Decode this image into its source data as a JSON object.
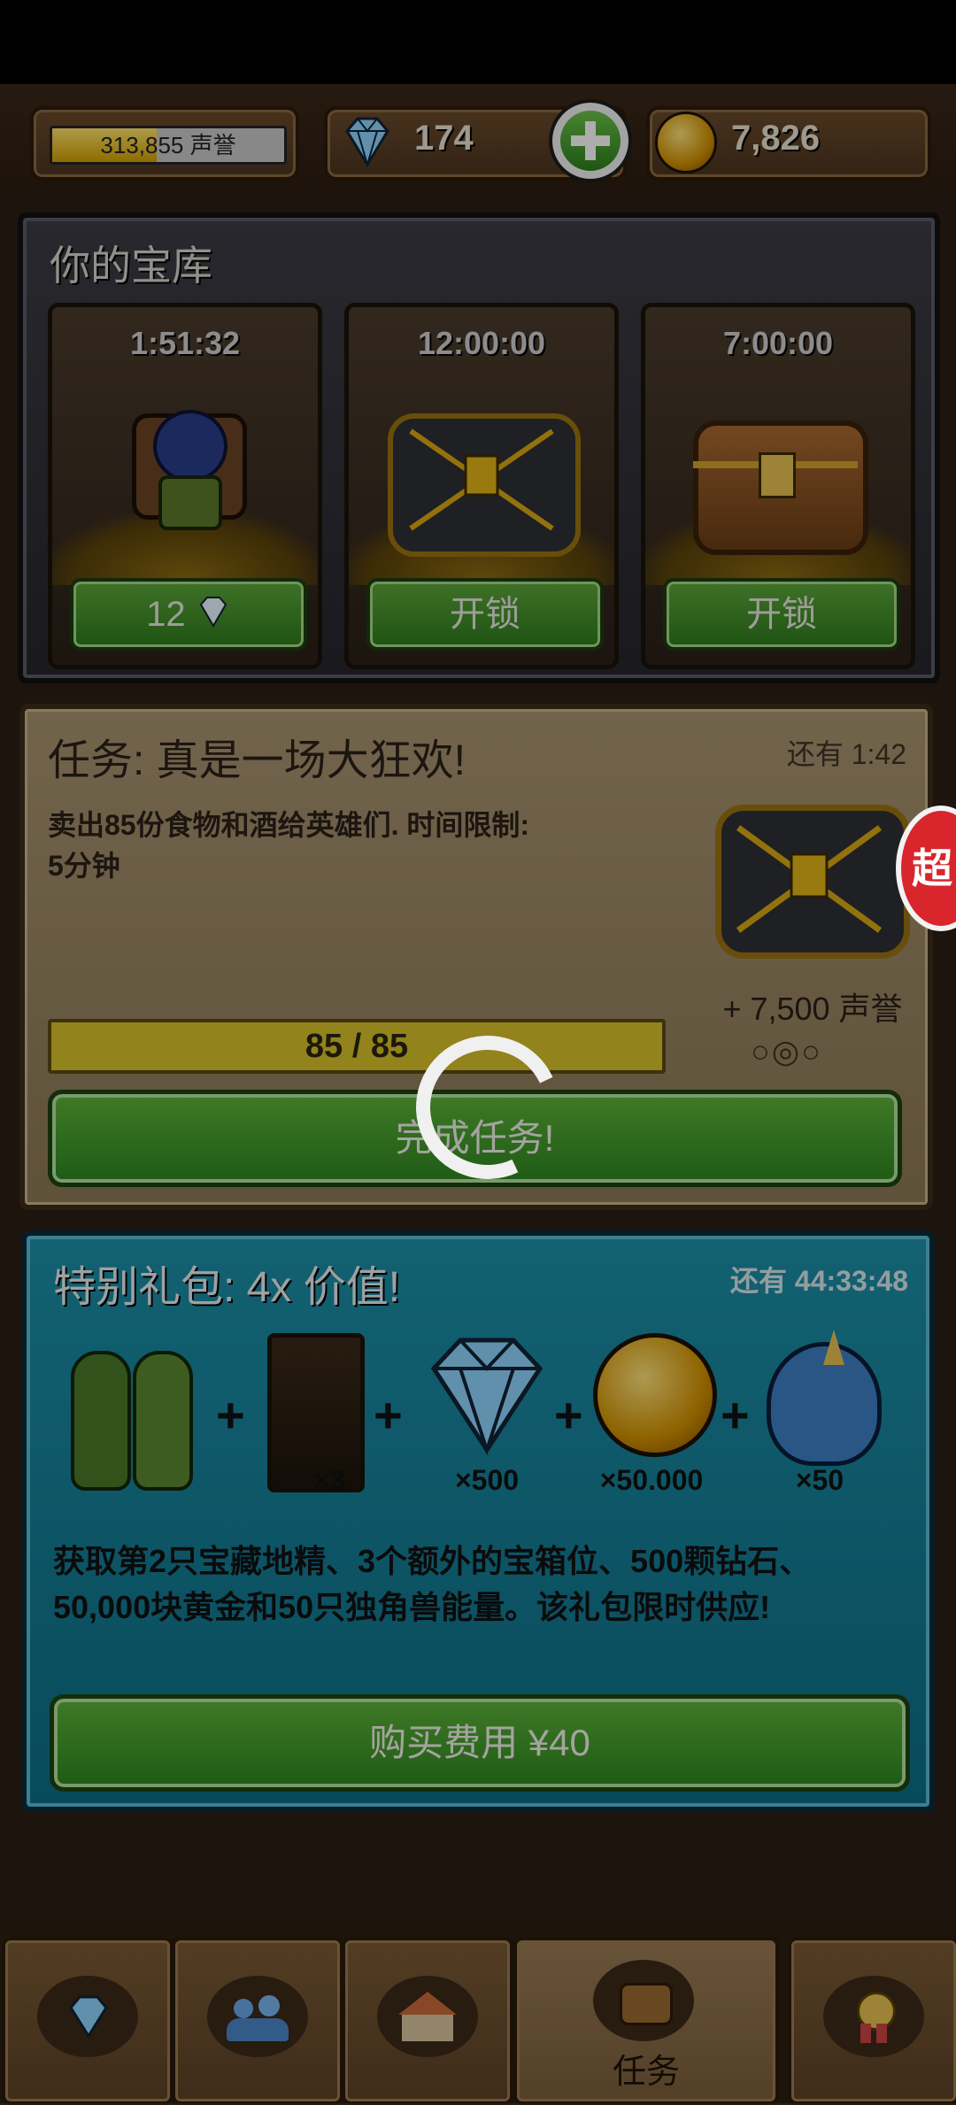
{
  "hud": {
    "reputation": {
      "value": "313,855",
      "unit": "声誉",
      "progress_fraction": 0.45
    },
    "gems": "174",
    "gold": "7,826"
  },
  "vault": {
    "title": "你的宝库",
    "slots": [
      {
        "timer": "1:51:32",
        "button": "12"
      },
      {
        "timer": "12:00:00",
        "button": "开锁"
      },
      {
        "timer": "7:00:00",
        "button": "开锁"
      }
    ]
  },
  "quest": {
    "title": "任务: 真是一场大狂欢!",
    "time_left": "还有 1:42",
    "description_line1": "卖出85份食物和酒给英雄们. 时间限制:",
    "description_line2": "5分钟",
    "progress": "85 / 85",
    "progress_fraction": 1.0,
    "reward": "+ 7,500 声誉",
    "dots": "○◎○",
    "complete_button": "完成任务!"
  },
  "special_pack": {
    "title": "特别礼包:  4x 价值!",
    "time_left": "还有 44:33:48",
    "items": [
      {
        "qty": "×3"
      },
      {
        "qty": "×500"
      },
      {
        "qty": "×50.000"
      },
      {
        "qty": "×50"
      }
    ],
    "plus": "+",
    "description": "获取第2只宝藏地精、3个额外的宝箱位、500颗钻石、50,000块黄金和50只独角兽能量。该礼包限时供应!",
    "buy_button": "购买费用 ¥40"
  },
  "bottom_nav": {
    "active_tab_label": "任务"
  },
  "side_tab_label": "超"
}
